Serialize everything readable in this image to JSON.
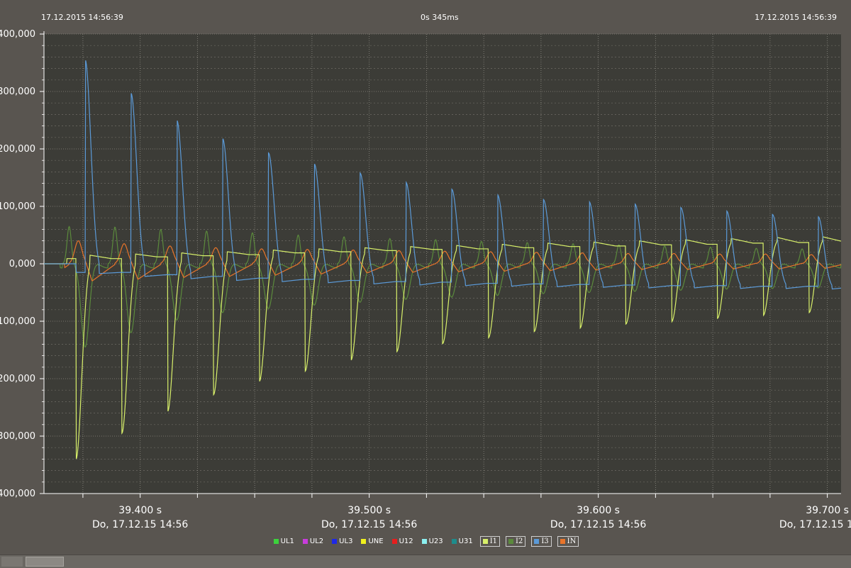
{
  "header": {
    "timestamp_left": "17.12.2015 14:56:39",
    "duration": "0s 345ms",
    "timestamp_right": "17.12.2015 14:56:39"
  },
  "colors": {
    "background": "#595550",
    "plot_background": "#3c3c37",
    "grid": "#8a8880"
  },
  "chart_data": {
    "type": "line",
    "title": "",
    "xlabel": "",
    "ylabel": "",
    "xlim": [
      39.358,
      39.706
    ],
    "ylim": [
      -400,
      400
    ],
    "y_ticks": [
      400,
      300,
      200,
      100,
      0,
      -100,
      -200,
      -300,
      -400
    ],
    "y_tick_labels": [
      "400,000",
      "300,000",
      "200,000",
      "100,000",
      "0,000",
      "-100,000",
      "-200,000",
      "-300,000",
      "-400,000"
    ],
    "x_ticks": [
      39.4,
      39.5,
      39.6,
      39.7
    ],
    "x_tick_labels": [
      "39.400 s",
      "39.500 s",
      "39.600 s",
      "39.700 s"
    ],
    "x_tick_sublabels": [
      "Do, 17.12.15 14:56",
      "Do, 17.12.15 14:56",
      "Do, 17.12.15 14:56",
      "Do, 17.12.15 14:56"
    ],
    "grid": true,
    "legend": "bottom",
    "pulse_period": 0.02,
    "series": [
      {
        "name": "I1",
        "color": "#d8f06a",
        "first_pulse_t": 39.372,
        "neg_peaks": [
          -340,
          -295,
          -257,
          -228,
          -205,
          -187,
          -168,
          -153,
          -139,
          -129,
          -118,
          -112,
          -105,
          -101,
          -95,
          -90,
          -85,
          -80
        ],
        "plateau_start": [
          15,
          17,
          19,
          21,
          24,
          26,
          28,
          30,
          32,
          34,
          36,
          38,
          40,
          42,
          44,
          46,
          47,
          48
        ],
        "plateau_end": [
          9,
          12,
          14,
          16,
          19,
          21,
          23,
          25,
          26,
          28,
          30,
          31,
          33,
          34,
          36,
          37,
          38,
          39
        ]
      },
      {
        "name": "I3",
        "color": "#5b9ad8",
        "first_pulse_t": 39.376,
        "pos_peaks": [
          355,
          297,
          250,
          218,
          193,
          174,
          158,
          142,
          130,
          120,
          112,
          108,
          104,
          98,
          92,
          86,
          82,
          78
        ],
        "plateau_start": [
          -17,
          -22,
          -26,
          -29,
          -31,
          -33,
          -35,
          -37,
          -38,
          -39,
          -40,
          -41,
          -42,
          -42,
          -43,
          -43,
          -44,
          -44
        ],
        "plateau_end": [
          -15,
          -19,
          -22,
          -25,
          -27,
          -29,
          -31,
          -32,
          -34,
          -35,
          -36,
          -37,
          -38,
          -38,
          -39,
          -39,
          -40,
          -40
        ]
      },
      {
        "name": "I2",
        "color": "#5b8a3c",
        "first_pulse_t": 39.369,
        "pos_peaks": [
          65,
          64,
          60,
          57,
          54,
          50,
          47,
          44,
          42,
          39,
          37,
          35,
          33,
          31,
          29,
          27,
          26,
          25
        ],
        "neg_peaks": [
          -145,
          -120,
          -98,
          -85,
          -78,
          -72,
          -67,
          -62,
          -58,
          -55,
          -52,
          -50,
          -48,
          -46,
          -44,
          -43,
          -42,
          -41
        ]
      },
      {
        "name": "IN",
        "color": "#e8742a",
        "first_pulse_t": 39.373,
        "peaks": [
          40,
          35,
          31,
          28,
          26,
          25,
          24,
          23,
          22,
          21,
          20,
          19,
          18,
          18,
          17,
          17,
          16,
          16
        ],
        "troughs": [
          -30,
          -27,
          -24,
          -22,
          -20,
          -18,
          -16,
          -15,
          -14,
          -13,
          -12,
          -11,
          -10,
          -10,
          -9,
          -9,
          -8,
          -8
        ]
      }
    ]
  },
  "legend_items": [
    {
      "label": "UL1",
      "color": "#3cd23c",
      "boxed": false
    },
    {
      "label": "UL2",
      "color": "#c83cdc",
      "boxed": false
    },
    {
      "label": "UL3",
      "color": "#1e28e6",
      "boxed": false
    },
    {
      "label": "UNE",
      "color": "#f0f01e",
      "boxed": false
    },
    {
      "label": "U12",
      "color": "#e61e1e",
      "boxed": false
    },
    {
      "label": "U23",
      "color": "#8cf0f0",
      "boxed": false
    },
    {
      "label": "U31",
      "color": "#1e8c8c",
      "boxed": false
    },
    {
      "label": "I1",
      "color": "#d8f06a",
      "boxed": true
    },
    {
      "label": "I2",
      "color": "#5b8a3c",
      "boxed": true
    },
    {
      "label": "I3",
      "color": "#5b9ad8",
      "boxed": true
    },
    {
      "label": "IN",
      "color": "#e8742a",
      "boxed": true
    }
  ]
}
